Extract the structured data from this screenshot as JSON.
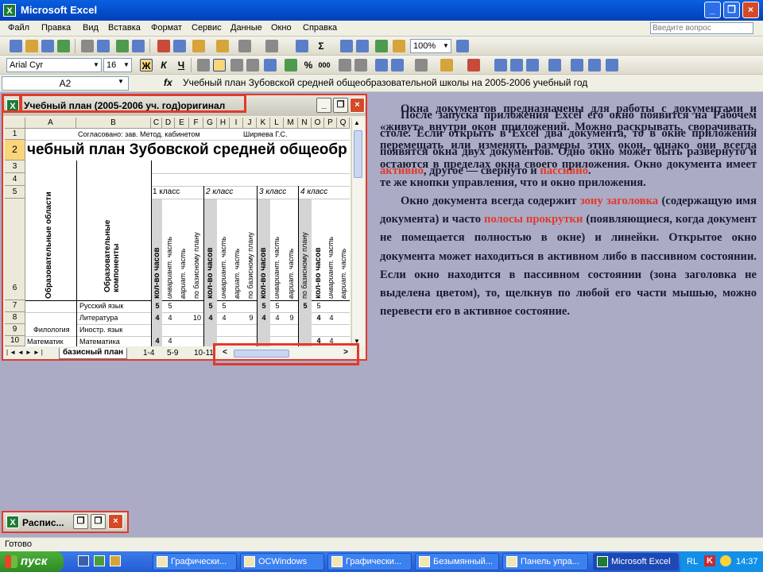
{
  "app": {
    "title": "Microsoft Excel",
    "minimize_label": "_",
    "restore_label": "❐",
    "close_label": "×"
  },
  "menu": {
    "items": [
      "Файл",
      "Правка",
      "Вид",
      "Вставка",
      "Формат",
      "Сервис",
      "Данные",
      "Окно",
      "Справка"
    ],
    "ask_placeholder": "Введите вопрос"
  },
  "toolbar": {
    "zoom": "100%",
    "font_name": "Arial Cyr",
    "font_size": "16",
    "bold": "Ж",
    "italic": "К",
    "underline": "Ч",
    "percent": "%",
    "thousands": "000"
  },
  "formula_bar": {
    "name_box": "A2",
    "fx": "fx",
    "formula": "Учебный план Зубовской средней общеобразовательной школы на 2005-2006 учебный год"
  },
  "doc_window": {
    "title": "Учебный план (2005-2006 уч. год)оригинал",
    "columns": [
      "A",
      "B",
      "C",
      "D",
      "E",
      "F",
      "G",
      "H",
      "I",
      "J",
      "K",
      "L",
      "M",
      "N",
      "O",
      "P",
      "Q"
    ],
    "rows": [
      "1",
      "2",
      "3",
      "4",
      "5",
      "6",
      "7",
      "8",
      "9",
      "10"
    ],
    "approved": "Согласовано: зав. Метод. кабинетом",
    "approver": "Ширяева Г.С.",
    "heading": "чебный план Зубовской средней общеобр",
    "col_a_header": "Образовательные области",
    "col_b_header": "Образовательные компоненты",
    "grades": [
      "1 класс",
      "2 класс",
      "3 класс",
      "4 класс"
    ],
    "vheader_hours": "кол-во часов",
    "vheader_inv": "инвариант. часть",
    "vheader_var": "вариат. часть",
    "vheader_base": "по базисному плану",
    "area_philology": "Филология",
    "area_math": "Математик",
    "subjects": [
      "Русский язык",
      "Литература",
      "Иностр. язык",
      "Математика"
    ],
    "values": {
      "r7": [
        "5",
        "5",
        "5",
        "5",
        "5",
        "5",
        "5",
        "5"
      ],
      "r8": [
        "4",
        "4",
        "10",
        "4",
        "4",
        "9",
        "4",
        "4",
        "9",
        "4",
        "4"
      ],
      "r10": [
        "4",
        "4",
        "4",
        "4"
      ]
    },
    "sheet_tabs": [
      "базисный план",
      "1-4",
      "5-9",
      "10-11"
    ]
  },
  "text": {
    "layer1": "После запуска приложения Excel его окно появится на Рабочем столе. Если открыть в Excel два документа, то в окне приложения появятся окна двух документов. Одно окно может быть развернуто и активно, другое — свернуто и пассивно.",
    "layer1_part1": "После запуска приложения Excel его окно появится на Рабочем столе. Если открыть в Excel два документа, то в окне приложения появятся окна двух документов. Одно окно может быть развернуто и ",
    "layer1_red1": "активно",
    "layer1_part2": ", другое — свернуто и ",
    "layer1_red2": "пассивно",
    "layer1_part3": ".",
    "p1": "Окна документов предназначены для работы с документами и «живут» внутри окон приложений. Можно раскрывать, сворачивать, перемещать или изменять размеры этих окон, однако они всегда остаются в пределах окна своего приложения. Окно документа имеет те же кнопки управления, что и окно приложения.",
    "p2_part1": "Окно документа всегда содержит ",
    "p2_red1": "зону заголовка",
    "p2_part2": " (содержащую имя документа) и часто ",
    "p2_red2": "полосы прокрутки",
    "p2_part3": " (появляющиеся, когда документ не помещается полностью в окне) и линейки. Открытое окно документа может находиться в активном либо в пассивном состоянии. Если окно находится в пассивном состоянии (зона заголовка не выделена цветом), то, щелкнув по любой его части мышью, можно перевести его в активное состояние."
  },
  "min_window": {
    "title": "Распис..."
  },
  "status": {
    "text": "Готово"
  },
  "taskbar": {
    "start": "пуск",
    "tasks": [
      "Графически...",
      "OCWindows",
      "Графически...",
      "Безымянный...",
      "Панель упра...",
      "Microsoft Excel"
    ],
    "lang": "RL",
    "clock": "14:37"
  },
  "colors": {
    "accent_red": "#E03A2A",
    "titlebar_blue": "#0A5FE0",
    "workspace": "#ABABC6"
  }
}
